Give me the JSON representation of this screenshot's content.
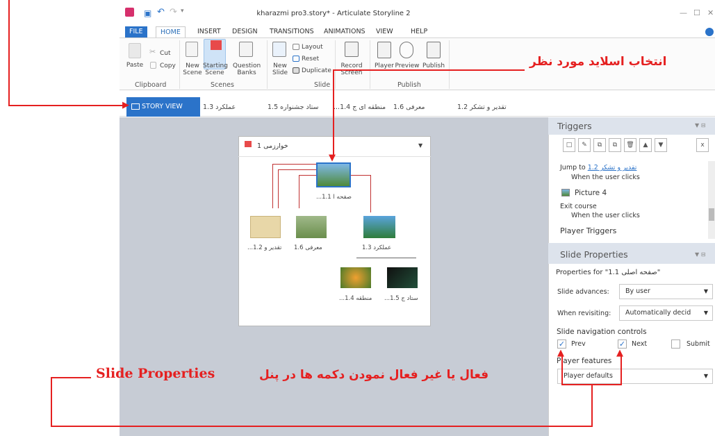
{
  "window": {
    "title": "kharazmi pro3.story* - Articulate Storyline 2"
  },
  "ribbon_tabs": [
    "FILE",
    "HOME",
    "INSERT",
    "DESIGN",
    "TRANSITIONS",
    "ANIMATIONS",
    "VIEW",
    "HELP"
  ],
  "ribbon": {
    "paste": "Paste",
    "cut": "Cut",
    "copy": "Copy",
    "clipboard_group": "Clipboard",
    "new_scene": "New Scene",
    "starting_scene": "Starting Scene",
    "question_banks": "Question Banks",
    "scenes_group": "Scenes",
    "new_slide": "New Slide",
    "layout": "Layout",
    "reset": "Reset",
    "duplicate": "Duplicate",
    "slide_group": "Slide",
    "record_screen": "Record Screen",
    "player": "Player",
    "preview": "Preview",
    "publish": "Publish",
    "publish_group": "Publish"
  },
  "slide_tabs": {
    "story_view": "STORY VIEW",
    "tabs": [
      "عملکرد 1.3",
      "ستاد جشنواره 1.5",
      "...منطقه ای ج 1.4",
      "معرفی 1.6",
      "تقدیر و تشکر 1.2"
    ]
  },
  "scene": {
    "title": "خوارزمی 1",
    "root_label": "...صفحه ا 1.1",
    "children": [
      "...تقدیر و 1.2",
      "معرفی 1.6",
      "عملکرد 1.3"
    ],
    "grandchildren": [
      "...منطقه 1.4",
      "...ستاد ج 1.5"
    ]
  },
  "triggers": {
    "heading": "Triggers",
    "items": [
      {
        "action": "Jump to",
        "link": "تقدیر و تشکر 1.2",
        "when": "When the user clicks"
      },
      {
        "object": "Picture 4"
      },
      {
        "action": "Exit course",
        "when": "When the user clicks"
      }
    ],
    "player_triggers": "Player Triggers"
  },
  "slide_properties": {
    "heading": "Slide Properties",
    "properties_for": "Properties for \"1.1 صفحه اصلی\"",
    "advances_label": "Slide advances:",
    "advances_value": "By user",
    "revisiting_label": "When revisiting:",
    "revisiting_value": "Automatically decid",
    "nav_controls": "Slide navigation controls",
    "prev": "Prev",
    "next": "Next",
    "submit": "Submit",
    "player_features": "Player features",
    "player_features_value": "Player defaults"
  },
  "annotations": {
    "select_slide": "انتخاب اسلاید مورد نظر",
    "toggle_buttons": "فعال یا غیر فعال نمودن دکمه ها در پنل",
    "panel_name": "Slide Properties"
  },
  "colors": {
    "accent": "#2b73c9",
    "annotation": "#e52020"
  }
}
